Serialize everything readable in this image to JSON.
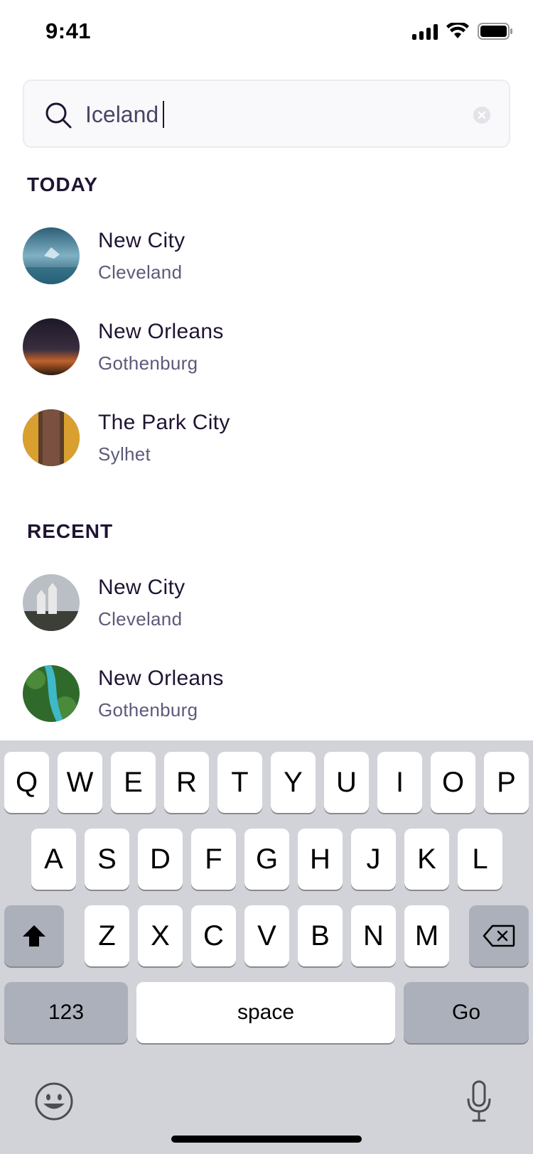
{
  "status_bar": {
    "time": "9:41"
  },
  "search": {
    "value": "Iceland"
  },
  "sections": {
    "today": {
      "title": "TODAY",
      "items": [
        {
          "title": "New City",
          "subtitle": "Cleveland"
        },
        {
          "title": "New Orleans",
          "subtitle": "Gothenburg"
        },
        {
          "title": "The Park City",
          "subtitle": "Sylhet"
        }
      ]
    },
    "recent": {
      "title": "RECENT",
      "items": [
        {
          "title": "New City",
          "subtitle": "Cleveland"
        },
        {
          "title": "New Orleans",
          "subtitle": "Gothenburg"
        }
      ]
    }
  },
  "keyboard": {
    "row1": [
      "Q",
      "W",
      "E",
      "R",
      "T",
      "Y",
      "U",
      "I",
      "O",
      "P"
    ],
    "row2": [
      "A",
      "S",
      "D",
      "F",
      "G",
      "H",
      "J",
      "K",
      "L"
    ],
    "row3": [
      "Z",
      "X",
      "C",
      "V",
      "B",
      "N",
      "M"
    ],
    "numbers_label": "123",
    "space_label": "space",
    "go_label": "Go"
  },
  "colors": {
    "text_primary": "#1f1432",
    "text_secondary": "#5c5a7a",
    "keyboard_bg": "#d1d3d9",
    "key_dark": "#abb0bb"
  }
}
